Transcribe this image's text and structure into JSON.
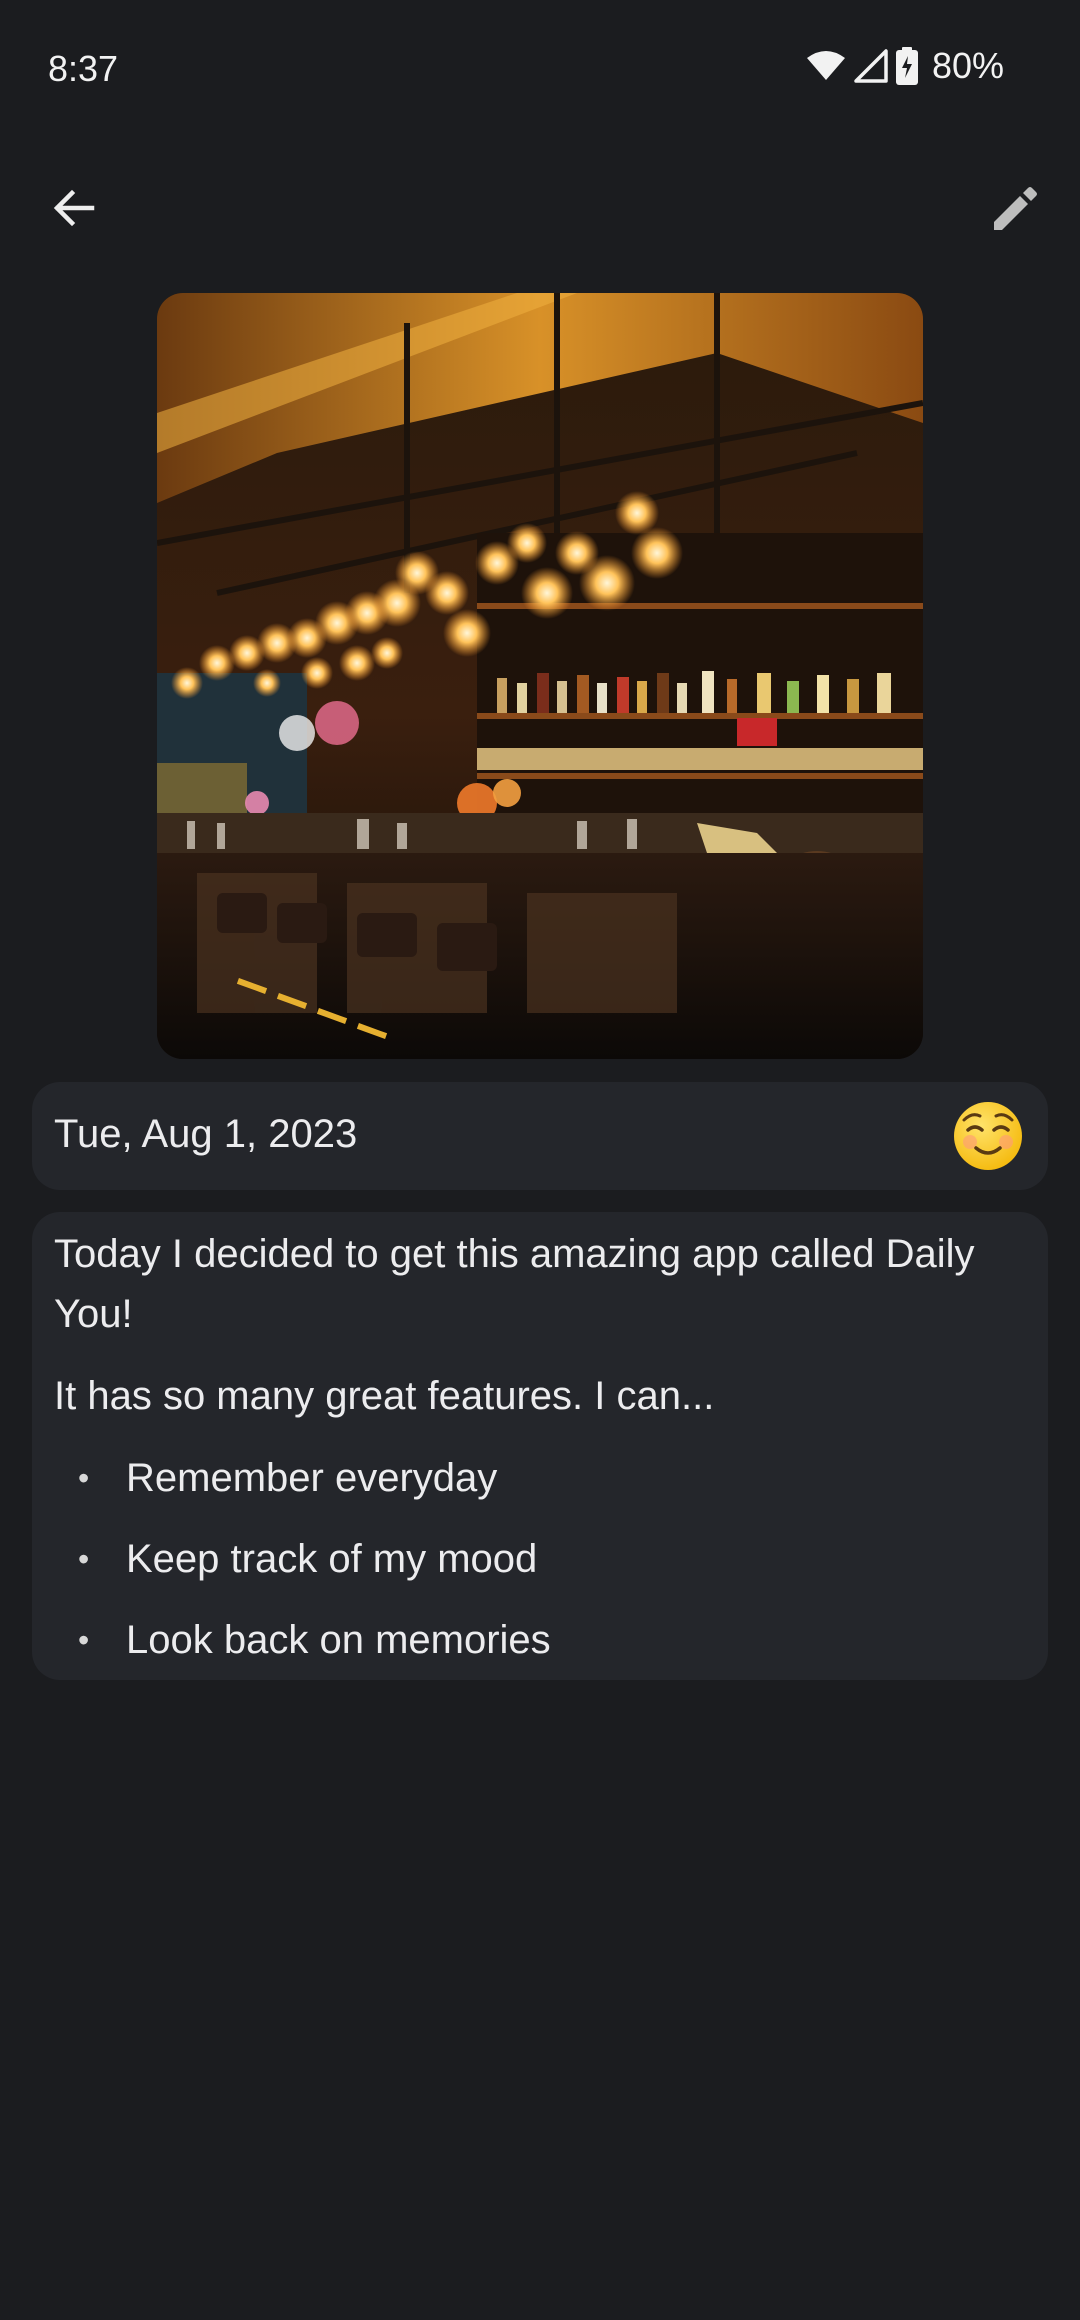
{
  "status_bar": {
    "time": "8:37",
    "battery": "80%",
    "icons": [
      "wifi-icon",
      "cell-signal-icon",
      "battery-charging-icon"
    ]
  },
  "app_bar": {
    "back_icon": "arrow-left-icon",
    "edit_icon": "pencil-icon"
  },
  "entry": {
    "image": "bar-interior-photo",
    "date": "Tue, Aug 1, 2023",
    "mood_icon": "smiling-face-emoji",
    "paragraphs": [
      "Today I decided to get this amazing app called Daily You!",
      "It has so many great features. I can..."
    ],
    "bullets": [
      "Remember everyday",
      "Keep track of my mood",
      "Look back on memories"
    ]
  },
  "colors": {
    "background": "#1b1c1f",
    "card": "#24262b",
    "text": "#ececee"
  }
}
